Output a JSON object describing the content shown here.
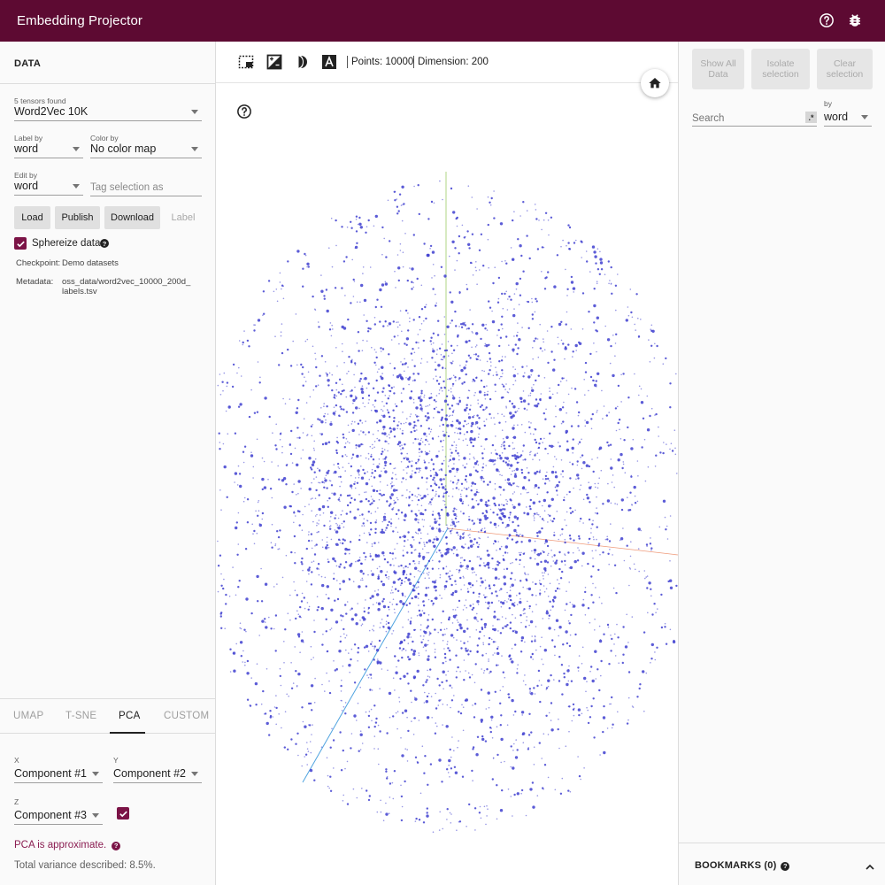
{
  "app": {
    "title": "Embedding Projector"
  },
  "header": {
    "help_icon": "help-circle-icon",
    "bug_icon": "bug-icon"
  },
  "data_panel": {
    "heading": "DATA",
    "tensors_label": "5 tensors found",
    "tensor_selected": "Word2Vec 10K",
    "label_by": {
      "label": "Label by",
      "value": "word"
    },
    "color_by": {
      "label": "Color by",
      "value": "No color map"
    },
    "edit_by": {
      "label": "Edit by",
      "value": "word"
    },
    "tag_placeholder": "Tag selection as",
    "buttons": {
      "load": "Load",
      "publish": "Publish",
      "download": "Download",
      "label": "Label"
    },
    "sphereize": {
      "label": "Sphereize data",
      "checked": true
    },
    "checkpoint": {
      "key": "Checkpoint:",
      "value": "Demo datasets"
    },
    "metadata": {
      "key": "Metadata:",
      "value": "oss_data/word2vec_10000_200d_\nlabels.tsv"
    }
  },
  "projection": {
    "tabs": [
      "UMAP",
      "T-SNE",
      "PCA",
      "CUSTOM"
    ],
    "active_tab": "PCA",
    "x": {
      "label": "X",
      "value": "Component #1"
    },
    "y": {
      "label": "Y",
      "value": "Component #2"
    },
    "z": {
      "label": "Z",
      "value": "Component #3",
      "enabled": true
    },
    "note": "PCA is approximate.",
    "variance": "Total variance described: 8.5%."
  },
  "toolbar": {
    "points": "Points: 10000",
    "dimension": "Dimension: 200",
    "icons": [
      "bounding-box-select-icon",
      "night-mode-icon",
      "contrast-icon",
      "label-text-icon"
    ]
  },
  "inspector": {
    "show_all": "Show All Data",
    "isolate": "Isolate selection",
    "clear": "Clear selection",
    "search_placeholder": "Search",
    "regex_glyph": ".*",
    "by_label": "by",
    "by_value": "word",
    "bookmarks": "BOOKMARKS (0)"
  },
  "colors": {
    "brand": "#5d0a32",
    "accent": "#7b1346",
    "point": "#3f3fd0"
  }
}
